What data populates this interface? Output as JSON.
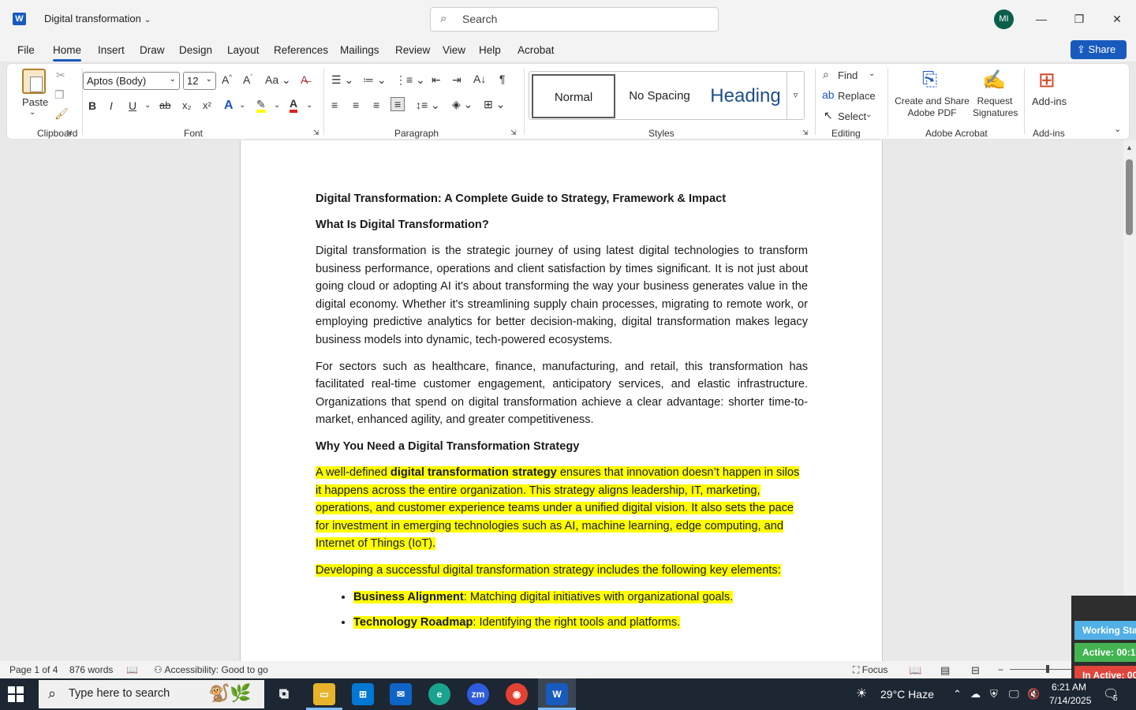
{
  "window": {
    "doc_title": "Digital transformation",
    "search_placeholder": "Search",
    "avatar_initials": "MI"
  },
  "menu": {
    "tabs": [
      "File",
      "Home",
      "Insert",
      "Draw",
      "Design",
      "Layout",
      "References",
      "Mailings",
      "Review",
      "View",
      "Help",
      "Acrobat"
    ],
    "active_tab": "Home",
    "share_label": "Share"
  },
  "ribbon": {
    "clipboard": {
      "paste": "Paste",
      "label": "Clipboard"
    },
    "font": {
      "family": "Aptos (Body)",
      "size": "12",
      "label": "Font"
    },
    "paragraph": {
      "label": "Paragraph"
    },
    "styles": {
      "items": [
        "Normal",
        "No Spacing",
        "Heading"
      ],
      "label": "Styles"
    },
    "editing": {
      "find": "Find",
      "replace": "Replace",
      "select": "Select",
      "label": "Editing"
    },
    "acrobat": {
      "create": "Create and Share Adobe PDF",
      "request": "Request Signatures",
      "label": "Adobe Acrobat"
    },
    "addins": {
      "button": "Add-ins",
      "label": "Add-ins"
    }
  },
  "document": {
    "title": "Digital Transformation: A Complete Guide to Strategy, Framework & Impact",
    "h_what": "What Is Digital Transformation?",
    "p1": "Digital transformation is the strategic journey of using latest digital technologies to transform business performance, operations and client satisfaction by times significant. It is not just about going cloud or adopting AI it's about transforming the way your business generates value in the digital economy. Whether it's streamlining supply chain processes, migrating to remote work, or employing predictive analytics for better decision-making, digital transformation makes legacy business models into dynamic, tech-powered ecosystems.",
    "p2": "For sectors such as healthcare, finance, manufacturing, and retail, this transformation has facilitated real-time customer engagement, anticipatory services, and elastic infrastructure. Organizations that spend on digital transformation achieve a clear advantage: shorter time-to-market, enhanced agility, and greater competitiveness.",
    "h_why": "Why You Need a Digital Transformation Strategy",
    "p3_pre": "A well-defined ",
    "p3_bold": "digital transformation strategy",
    "p3_post": " ensures that innovation doesn’t happen in silos it happens across the entire organization. This strategy aligns leadership, IT, marketing, operations, and customer experience teams under a unified digital vision. It also sets the pace for investment in emerging technologies such as AI, machine learning, edge computing, and Internet of Things (IoT).",
    "p4": "Developing a successful digital transformation strategy includes the following key elements:",
    "bullets": [
      {
        "bold": "Business Alignment",
        "text": ": Matching digital initiatives with organizational goals."
      },
      {
        "bold": "Technology Roadmap",
        "text": ": Identifying the right tools and platforms."
      }
    ]
  },
  "status": {
    "page": "Page 1 of 4",
    "words": "876 words",
    "accessibility": "Accessibility: Good to go",
    "focus": "Focus"
  },
  "tracker": {
    "working": "Working Sta",
    "active": "Active: 00:1",
    "inactive": "In Active: 00"
  },
  "taskbar": {
    "search_placeholder": "Type here to search",
    "weather": "29°C  Haze",
    "time": "6:21 AM",
    "date": "7/14/2025",
    "notif_count": "5"
  },
  "colors": {
    "accent": "#185abd",
    "highlight": "#ffff00",
    "taskbar": "#1c2733"
  }
}
